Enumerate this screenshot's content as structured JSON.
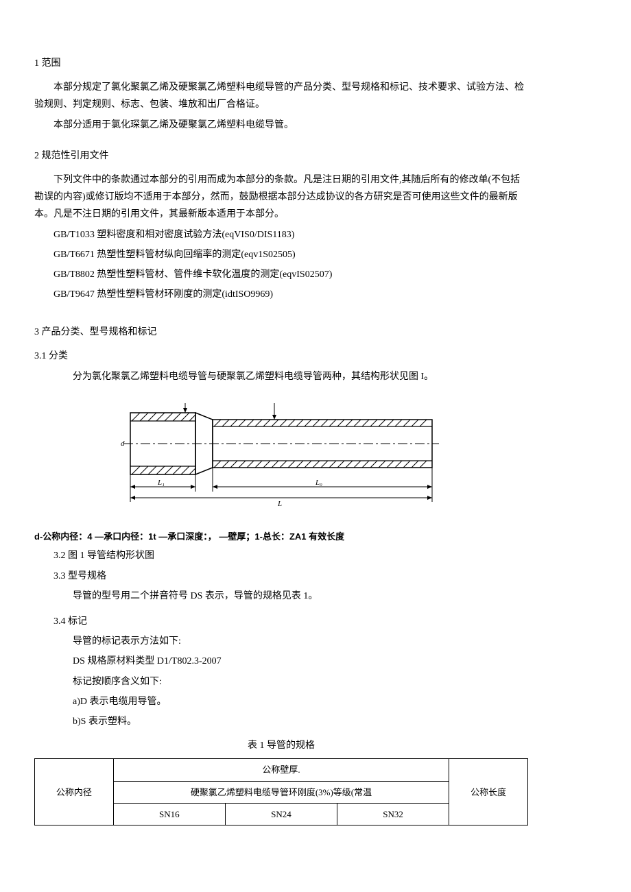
{
  "s1": {
    "heading": "1 范围",
    "p1": "本部分规定了氯化聚氯乙烯及硬聚氯乙烯塑料电缆导管的产品分类、型号规格和标记、技术要求、试验方法、检验规则、判定规则、标志、包装、堆放和出厂合格证。",
    "p2": "本部分适用于氯化琛氯乙烯及硬聚氯乙烯塑料电缆导管。"
  },
  "s2": {
    "heading": "2 规范性引用文件",
    "p1": "下列文件中的条款通过本部分的引用而成为本部分的条款。凡是注日期的引用文件,其随后所有的修改单(不包括勘误的内容)或修订版均不适用于本部分，然而，鼓励根据本部分达成协议的各方研究是否可使用这些文件的最新版本。凡是不注日期的引用文件，其最新版本适用于本部分。",
    "refs": [
      "GB/T1033    塑料密度和相对密度试验方法(eqVIS0/DIS1183)",
      "GB/T6671 热塑性塑料管材纵向回缩率的测定(eqv1S02505)",
      "GB/T8802 热塑性塑料管材、管件维卡软化温度的测定(eqvIS02507)",
      "GB/T9647 热塑性塑料管材环刚度的测定(idtISO9969)"
    ]
  },
  "s3": {
    "heading": "3 产品分类、型号规格和标记",
    "s31_heading": "3.1  分类",
    "s31_p1": "分为氯化聚氯乙烯塑料电缆导管与硬聚氯乙烯塑料电缆导管两种，其结构形状见图 I。",
    "fig_caption": "d-公称内径：4 —承口内径：1t —承口深度：， —壁厚；1-总长：ZA1 有效长度",
    "s32_heading": "3.2  图 1 导管结构形状图",
    "s33_heading": "3.3  型号规格",
    "s33_p1": "导管的型号用二个拼音符号 DS 表示，导管的规格见表 1。",
    "s34_heading": "3.4  标记",
    "s34_lines": [
      "导管的标记表示方法如下:",
      "DS 规格原材料类型 D1/T802.3-2007",
      "标记按顺序含义如下:",
      "a)D 表示电缆用导管。",
      "b)S 表示塑料。"
    ],
    "table_title": "表 1 导管的规格",
    "table": {
      "col_inner_dia": "公称内径",
      "col_thickness": "公称壁厚.",
      "col_subhead": "硬聚氯乙烯塑料电缆导管环刚度(3%)等级(常温",
      "col_length": "公称长度",
      "grades": [
        "SN16",
        "SN24",
        "SN32"
      ]
    }
  }
}
